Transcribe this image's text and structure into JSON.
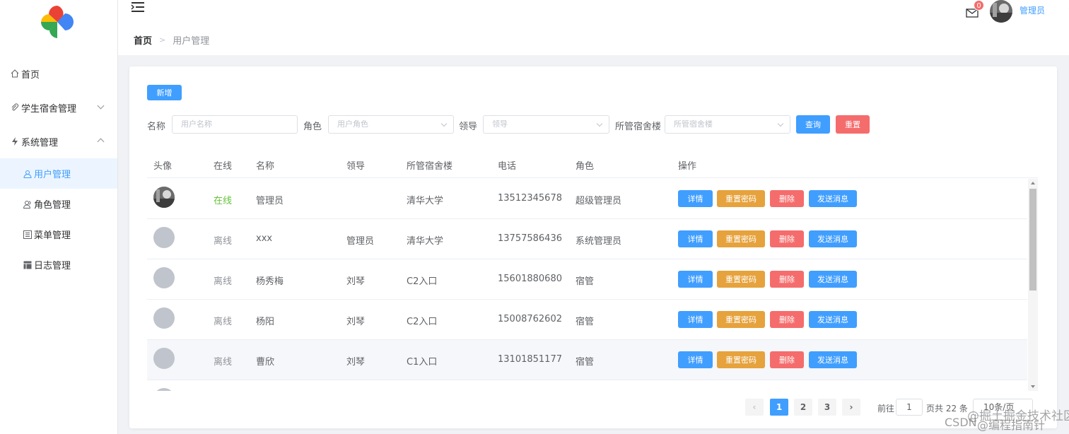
{
  "sidebar": {
    "items": [
      {
        "label": "首页",
        "icon": "home-icon"
      },
      {
        "label": "学生宿舍管理",
        "icon": "paperclip-icon"
      },
      {
        "label": "系统管理",
        "icon": "lightning-icon"
      }
    ],
    "subitems": [
      {
        "label": "用户管理",
        "icon": "user-icon"
      },
      {
        "label": "角色管理",
        "icon": "users-icon"
      },
      {
        "label": "菜单管理",
        "icon": "list-icon"
      },
      {
        "label": "日志管理",
        "icon": "table-icon"
      }
    ]
  },
  "header": {
    "badge": "0",
    "username": "管理员"
  },
  "breadcrumb": {
    "home": "首页",
    "sep": ">",
    "current": "用户管理"
  },
  "toolbar": {
    "add_label": "新增"
  },
  "filters": {
    "name_label": "名称",
    "name_placeholder": "用户名称",
    "role_label": "角色",
    "role_placeholder": "用户角色",
    "leader_label": "领导",
    "leader_placeholder": "领导",
    "building_label": "所管宿舍楼",
    "building_placeholder": "所管宿舍楼",
    "search_label": "查询",
    "reset_label": "重置"
  },
  "table": {
    "headers": [
      "头像",
      "在线",
      "名称",
      "领导",
      "所管宿舍楼",
      "电话",
      "角色",
      "操作"
    ],
    "rows": [
      {
        "status": "在线",
        "name": "管理员",
        "leader": "",
        "building": "清华大学",
        "phone": "13512345678",
        "role": "超级管理员"
      },
      {
        "status": "离线",
        "name": "xxx",
        "leader": "管理员",
        "building": "清华大学",
        "phone": "13757586436",
        "role": "系统管理员"
      },
      {
        "status": "离线",
        "name": "杨秀梅",
        "leader": "刘琴",
        "building": "C2入口",
        "phone": "15601880680",
        "role": "宿管"
      },
      {
        "status": "离线",
        "name": "杨阳",
        "leader": "刘琴",
        "building": "C2入口",
        "phone": "15008762602",
        "role": "宿管"
      },
      {
        "status": "离线",
        "name": "曹欣",
        "leader": "刘琴",
        "building": "C1入口",
        "phone": "13101851177",
        "role": "宿管"
      }
    ],
    "actions": {
      "detail": "详情",
      "reset_pwd": "重置密码",
      "delete": "删除",
      "send_msg": "发送消息"
    }
  },
  "pagination": {
    "pages": [
      "1",
      "2",
      "3"
    ],
    "current": "1",
    "goto_label": "前往",
    "goto_value": "1",
    "total_text": "页共 22 条",
    "page_size": "10条/页"
  },
  "watermark": {
    "line1": "CSDN",
    "line2": "@掘土掘金技术社区",
    "line3": "@编程指南针"
  },
  "colors": {
    "primary": "#409eff",
    "warning": "#e6a23c",
    "danger": "#f56c6c",
    "success": "#67c23a"
  }
}
